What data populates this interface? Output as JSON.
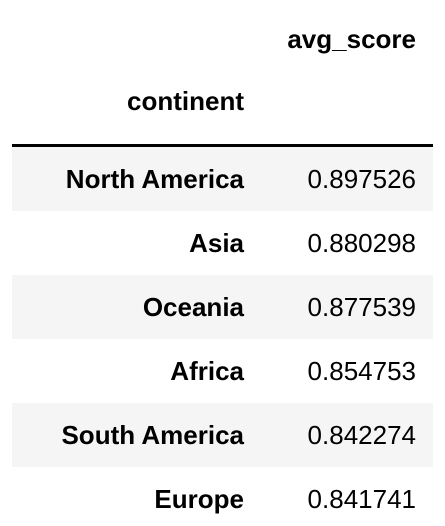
{
  "table": {
    "columns": [
      "avg_score"
    ],
    "index_name": "continent",
    "rows": [
      {
        "continent": "North America",
        "avg_score": "0.897526"
      },
      {
        "continent": "Asia",
        "avg_score": "0.880298"
      },
      {
        "continent": "Oceania",
        "avg_score": "0.877539"
      },
      {
        "continent": "Africa",
        "avg_score": "0.854753"
      },
      {
        "continent": "South America",
        "avg_score": "0.842274"
      },
      {
        "continent": "Europe",
        "avg_score": "0.841741"
      }
    ]
  },
  "colors": {
    "text": "#000000",
    "background": "#ffffff",
    "stripe": "#f5f5f5",
    "header_rule": "#000000"
  }
}
